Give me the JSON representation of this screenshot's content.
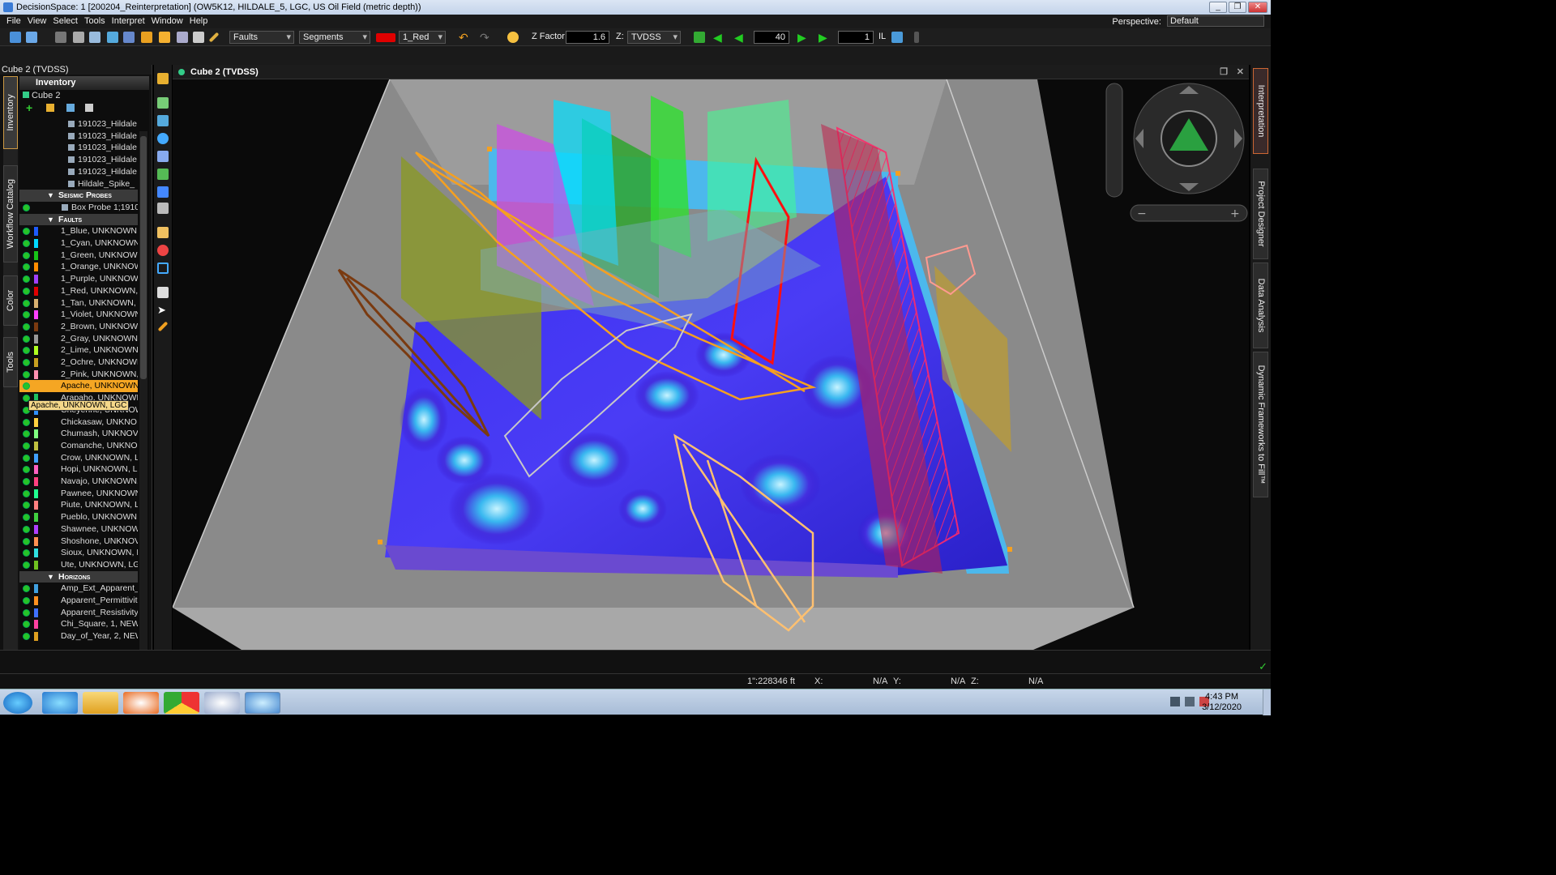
{
  "window": {
    "title": "DecisionSpace: 1 [200204_Reinterpretation] (OW5K12, HILDALE_5, LGC, US Oil Field (metric depth))",
    "min": "_",
    "max": "❐",
    "close": "✕"
  },
  "menu": [
    "File",
    "View",
    "Select",
    "Tools",
    "Interpret",
    "Window",
    "Help"
  ],
  "perspective": {
    "label": "Perspective:",
    "value": "Default"
  },
  "toolbar": {
    "object_type": "Faults",
    "mode": "Segments",
    "color_name": "1_Red",
    "color_hex": "#e00000",
    "zfactor_label": "Z Factor:",
    "zfactor_value": "1.6",
    "z_label": "Z:",
    "z_domain": "TVDSS",
    "step_value": "40",
    "line_value": "1",
    "line_type": "IL"
  },
  "left_panel": {
    "title": "Cube 2 (TVDSS)",
    "vtabs": [
      "Inventory",
      "Workflow Catalog",
      "Color",
      "Tools"
    ],
    "inventory_title": "Inventory",
    "inventory_sub": "Cube 2",
    "rows": [
      {
        "type": "item",
        "label": "191023_Hildale",
        "icon": true
      },
      {
        "type": "item",
        "label": "191023_Hildale",
        "icon": true
      },
      {
        "type": "item",
        "label": "191023_Hildale",
        "icon": true
      },
      {
        "type": "item",
        "label": "191023_Hildale",
        "icon": true
      },
      {
        "type": "item",
        "label": "191023_Hildale",
        "icon": true
      },
      {
        "type": "item",
        "label": "Hildale_Spike_",
        "icon": true
      },
      {
        "type": "section",
        "label": "Seismic Probes"
      },
      {
        "type": "item",
        "label": "Box Probe 1;1910",
        "dot": true,
        "icon": true
      },
      {
        "type": "section",
        "label": "Faults"
      },
      {
        "type": "item",
        "label": "1_Blue, UNKNOWN",
        "dot": true,
        "color": "#1e5bff"
      },
      {
        "type": "item",
        "label": "1_Cyan, UNKNOWN",
        "dot": true,
        "color": "#00d8ff"
      },
      {
        "type": "item",
        "label": "1_Green, UNKNOW",
        "dot": true,
        "color": "#17c317"
      },
      {
        "type": "item",
        "label": "1_Orange, UNKNOW",
        "dot": true,
        "color": "#ff8c00"
      },
      {
        "type": "item",
        "label": "1_Purple, UNKNOW",
        "dot": true,
        "color": "#a040ff"
      },
      {
        "type": "item",
        "label": "1_Red, UNKNOWN,",
        "dot": true,
        "color": "#e00000"
      },
      {
        "type": "item",
        "label": "1_Tan, UNKNOWN,",
        "dot": true,
        "color": "#d8b070"
      },
      {
        "type": "item",
        "label": "1_Violet, UNKNOWN",
        "dot": true,
        "color": "#ff40ff"
      },
      {
        "type": "item",
        "label": "2_Brown, UNKNOWN",
        "dot": true,
        "color": "#7a3a10"
      },
      {
        "type": "item",
        "label": "2_Gray, UNKNOWN",
        "dot": true,
        "color": "#999999"
      },
      {
        "type": "item",
        "label": "2_Lime, UNKNOWN",
        "dot": true,
        "color": "#b0ff20"
      },
      {
        "type": "item",
        "label": "2_Ochre, UNKNOWI",
        "dot": true,
        "color": "#c8a020"
      },
      {
        "type": "item",
        "label": "2_Pink, UNKNOWN,",
        "dot": true,
        "color": "#ff90b0"
      },
      {
        "type": "item",
        "label": "Apache, UNKNOWN",
        "dot": true,
        "color": "#f5a623",
        "selected": true
      },
      {
        "type": "item",
        "label": "Arapaho, UNKNOWI",
        "dot": true,
        "color": "#20c060"
      },
      {
        "type": "item",
        "label": "Cheyenne, UNKNOW",
        "dot": true,
        "color": "#3090ff"
      },
      {
        "type": "item",
        "label": "Chickasaw, UNKNO",
        "dot": true,
        "color": "#ffd040"
      },
      {
        "type": "item",
        "label": "Chumash, UNKNOV",
        "dot": true,
        "color": "#80ff80"
      },
      {
        "type": "item",
        "label": "Comanche, UNKNO",
        "dot": true,
        "color": "#c0c040"
      },
      {
        "type": "item",
        "label": "Crow, UNKNOWN, L",
        "dot": true,
        "color": "#40a0ff"
      },
      {
        "type": "item",
        "label": "Hopi, UNKNOWN, L",
        "dot": true,
        "color": "#ff60c0"
      },
      {
        "type": "item",
        "label": "Navajo, UNKNOWN,",
        "dot": true,
        "color": "#ff4080"
      },
      {
        "type": "item",
        "label": "Pawnee, UNKNOWN",
        "dot": true,
        "color": "#20ff90"
      },
      {
        "type": "item",
        "label": "Piute, UNKNOWN, L",
        "dot": true,
        "color": "#ff8080"
      },
      {
        "type": "item",
        "label": "Pueblo, UNKNOWN",
        "dot": true,
        "color": "#40d040"
      },
      {
        "type": "item",
        "label": "Shawnee, UNKNOW",
        "dot": true,
        "color": "#b040ff"
      },
      {
        "type": "item",
        "label": "Shoshone, UNKNOV",
        "dot": true,
        "color": "#ff9050"
      },
      {
        "type": "item",
        "label": "Sioux, UNKNOWN, L",
        "dot": true,
        "color": "#30e0e0"
      },
      {
        "type": "item",
        "label": "Ute, UNKNOWN, LG",
        "dot": true,
        "color": "#70c020"
      },
      {
        "type": "section",
        "label": "Horizons"
      },
      {
        "type": "item",
        "label": "Amp_Ext_Apparent_",
        "dot": true,
        "color": "#40a0e0"
      },
      {
        "type": "item",
        "label": "Apparent_Permittivit",
        "dot": true,
        "color": "#ff9020"
      },
      {
        "type": "item",
        "label": "Apparent_Resistivity",
        "dot": true,
        "color": "#4070ff"
      },
      {
        "type": "item",
        "label": "Chi_Square, 1, NEW",
        "dot": true,
        "color": "#ff40a0"
      },
      {
        "type": "item",
        "label": "Day_of_Year, 2, NEW",
        "dot": true,
        "color": "#e0a020"
      }
    ],
    "tooltip": "Apache, UNKNOWN, LGC"
  },
  "viewer": {
    "title": "Cube 2 (TVDSS)"
  },
  "right_rail": [
    "Interpretation",
    "Project Designer",
    "Data Analysis",
    "Dynamic Frameworks to Fill™"
  ],
  "status": {
    "scale": "1\":228346 ft",
    "x_label": "X:",
    "x_value": "N/A",
    "y_label": "Y:",
    "y_value": "N/A",
    "z_label": "Z:",
    "z_value": "N/A"
  },
  "taskbar": {
    "time": "4:43 PM",
    "date": "3/12/2020"
  }
}
